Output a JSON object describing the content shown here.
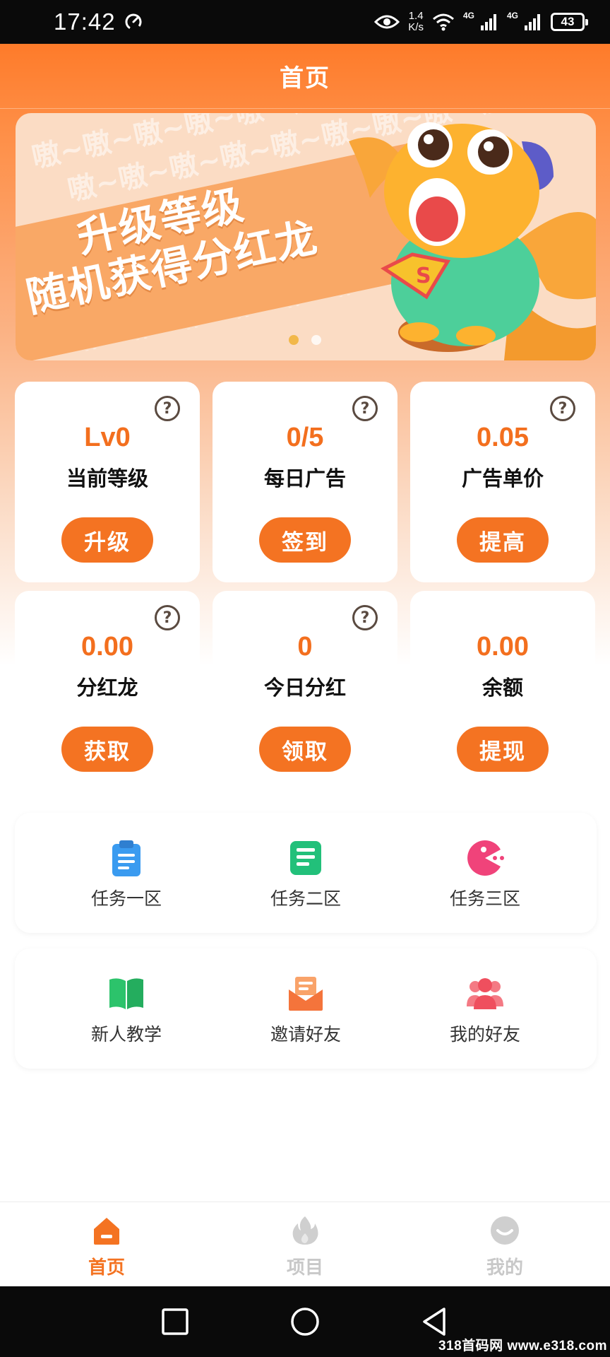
{
  "status_bar": {
    "time": "17:42",
    "net_speed_value": "1.4",
    "net_speed_unit": "K/s",
    "signal_label_1": "4G",
    "signal_label_2": "4G",
    "battery": "43"
  },
  "header": {
    "title": "首页"
  },
  "banner": {
    "line1": "升级等级",
    "line2": "随机获得分红龙",
    "bg_text": "嗷~嗷~嗷~嗷~嗷~嗷~嗷~嗷~嗷~",
    "badge_letter": "S",
    "slides": 2,
    "active_slide": 1
  },
  "stats": [
    {
      "value": "Lv0",
      "label": "当前等级",
      "button": "升级",
      "has_help": true
    },
    {
      "value": "0/5",
      "label": "每日广告",
      "button": "签到",
      "has_help": true
    },
    {
      "value": "0.05",
      "label": "广告单价",
      "button": "提高",
      "has_help": true
    },
    {
      "value": "0.00",
      "label": "分红龙",
      "button": "获取",
      "has_help": true
    },
    {
      "value": "0",
      "label": "今日分红",
      "button": "领取",
      "has_help": true
    },
    {
      "value": "0.00",
      "label": "余额",
      "button": "提现",
      "has_help": false
    }
  ],
  "help_glyph": "?",
  "menu_row1": [
    {
      "label": "任务一区",
      "icon": "clipboard-icon",
      "color": "#3a9bf0"
    },
    {
      "label": "任务二区",
      "icon": "document-list-icon",
      "color": "#22c07a"
    },
    {
      "label": "任务三区",
      "icon": "pacman-icon",
      "color": "#f0437a"
    }
  ],
  "menu_row2": [
    {
      "label": "新人教学",
      "icon": "book-icon",
      "color": "#2cc36b"
    },
    {
      "label": "邀请好友",
      "icon": "envelope-icon",
      "color": "#f4743b"
    },
    {
      "label": "我的好友",
      "icon": "group-icon",
      "color": "#ef4f5e"
    }
  ],
  "tabs": [
    {
      "label": "首页",
      "icon": "home-icon",
      "active": true
    },
    {
      "label": "项目",
      "icon": "fire-icon",
      "active": false
    },
    {
      "label": "我的",
      "icon": "smile-icon",
      "active": false
    }
  ],
  "colors": {
    "accent": "#f47322",
    "value_orange": "#f36f1e",
    "tab_active": "#f47322",
    "tab_inactive": "#c8c8c8"
  },
  "watermark": "318首码网 www.e318.com"
}
